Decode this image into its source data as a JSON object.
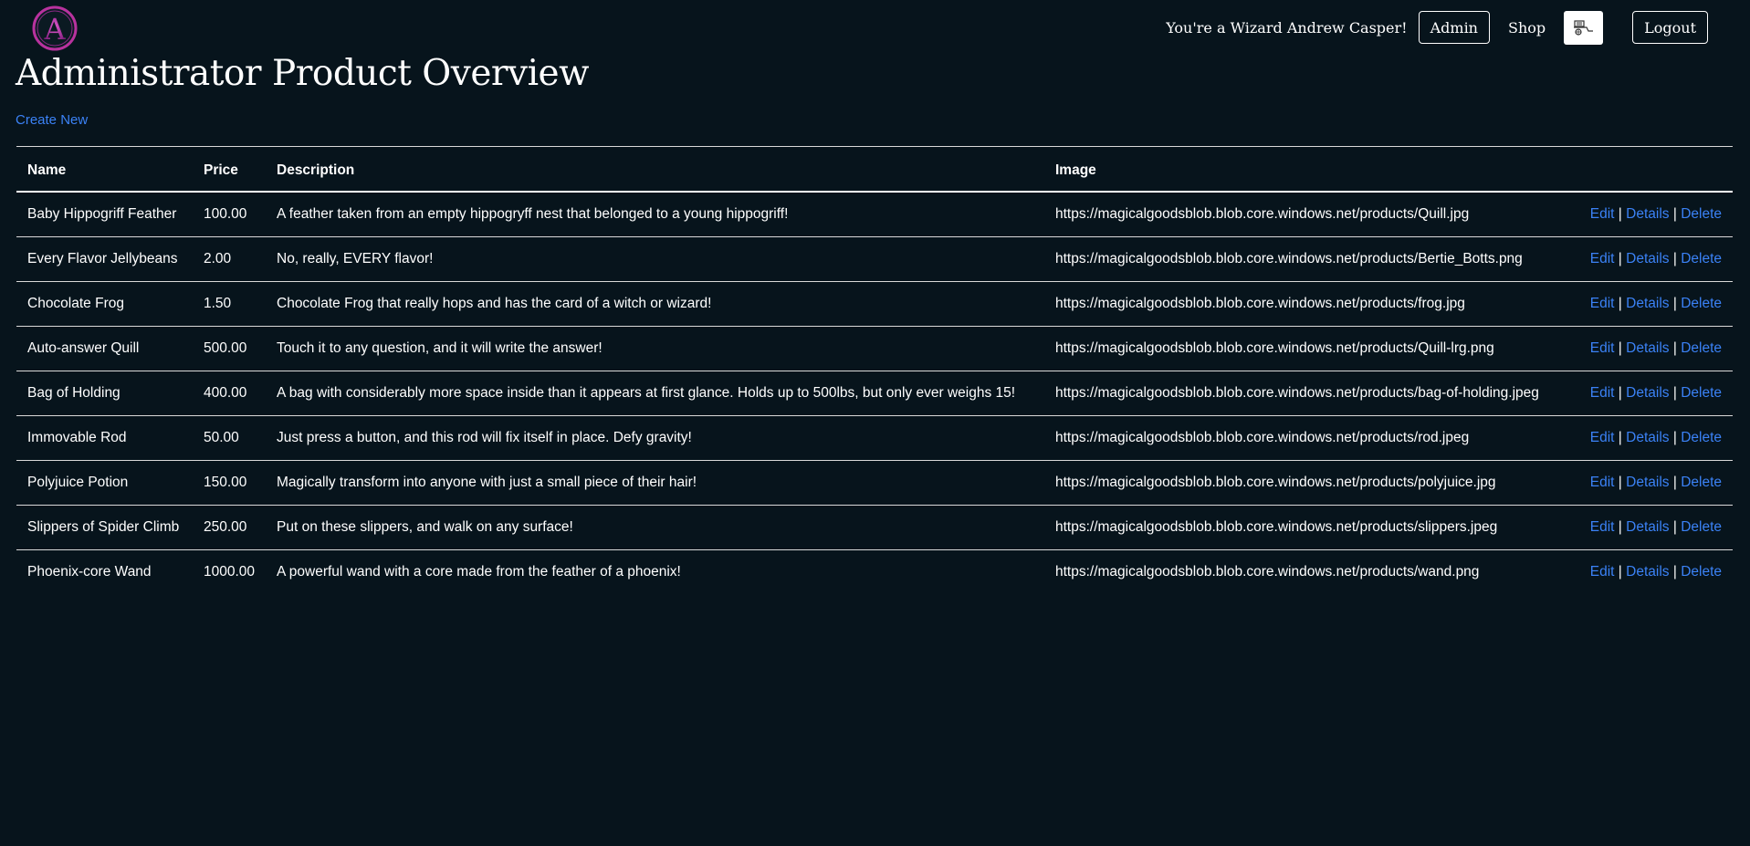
{
  "nav": {
    "logo_letter": "A",
    "greeting": "You're a Wizard Andrew Casper!",
    "admin_label": "Admin",
    "shop_label": "Shop",
    "cart_icon": "cart-icon",
    "logout_label": "Logout"
  },
  "page": {
    "title": "Administrator Product Overview",
    "create_new": "Create New"
  },
  "table": {
    "headers": {
      "name": "Name",
      "price": "Price",
      "description": "Description",
      "image": "Image"
    },
    "action_labels": {
      "edit": "Edit",
      "details": "Details",
      "delete": "Delete",
      "separator": "|"
    },
    "rows": [
      {
        "name": "Baby Hippogriff Feather",
        "price": "100.00",
        "description": "A feather taken from an empty hippogryff nest that belonged to a young hippogriff!",
        "image": "https://magicalgoodsblob.blob.core.windows.net/products/Quill.jpg"
      },
      {
        "name": "Every Flavor Jellybeans",
        "price": "2.00",
        "description": "No, really, EVERY flavor!",
        "image": "https://magicalgoodsblob.blob.core.windows.net/products/Bertie_Botts.png"
      },
      {
        "name": "Chocolate Frog",
        "price": "1.50",
        "description": "Chocolate Frog that really hops and has the card of a witch or wizard!",
        "image": "https://magicalgoodsblob.blob.core.windows.net/products/frog.jpg"
      },
      {
        "name": "Auto-answer Quill",
        "price": "500.00",
        "description": "Touch it to any question, and it will write the answer!",
        "image": "https://magicalgoodsblob.blob.core.windows.net/products/Quill-lrg.png"
      },
      {
        "name": "Bag of Holding",
        "price": "400.00",
        "description": "A bag with considerably more space inside than it appears at first glance. Holds up to 500lbs, but only ever weighs 15!",
        "image": "https://magicalgoodsblob.blob.core.windows.net/products/bag-of-holding.jpeg"
      },
      {
        "name": "Immovable Rod",
        "price": "50.00",
        "description": "Just press a button, and this rod will fix itself in place. Defy gravity!",
        "image": "https://magicalgoodsblob.blob.core.windows.net/products/rod.jpeg"
      },
      {
        "name": "Polyjuice Potion",
        "price": "150.00",
        "description": "Magically transform into anyone with just a small piece of their hair!",
        "image": "https://magicalgoodsblob.blob.core.windows.net/products/polyjuice.jpg"
      },
      {
        "name": "Slippers of Spider Climb",
        "price": "250.00",
        "description": "Put on these slippers, and walk on any surface!",
        "image": "https://magicalgoodsblob.blob.core.windows.net/products/slippers.jpeg"
      },
      {
        "name": "Phoenix-core Wand",
        "price": "1000.00",
        "description": "A powerful wand with a core made from the feather of a phoenix!",
        "image": "https://magicalgoodsblob.blob.core.windows.net/products/wand.png"
      }
    ]
  },
  "colors": {
    "background": "#07141c",
    "link": "#3b82f6",
    "logo_accent": "#b8329e"
  }
}
